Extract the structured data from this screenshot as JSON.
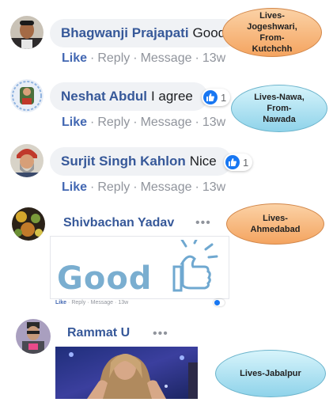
{
  "comments": [
    {
      "name": "Bhagwanji Prajapati",
      "text": "Good",
      "like": "Like",
      "reply": "Reply",
      "message": "Message",
      "time": "13w"
    },
    {
      "name": "Neshat Abdul",
      "text": "I agree",
      "reaction_count": "1",
      "like": "Like",
      "reply": "Reply",
      "message": "Message",
      "time": "13w"
    },
    {
      "name": "Surjit Singh Kahlon",
      "text": "Nice",
      "reaction_count": "1",
      "like": "Like",
      "reply": "Reply",
      "message": "Message",
      "time": "13w"
    },
    {
      "name": "Shivbachan Yadav",
      "more": "•••",
      "sticker_text": "Good",
      "like": "Like",
      "reply": "Reply",
      "message": "Message",
      "time": "13w"
    },
    {
      "name": "Rammat U",
      "more": "•••"
    }
  ],
  "dot": "·",
  "annotations": [
    {
      "text": "Lives-Jogeshwari, From-Kutchchh",
      "color": "orange"
    },
    {
      "text": "Lives-Nawa, From-Nawada",
      "color": "blue"
    },
    {
      "text": "Lives-Ahmedabad",
      "color": "orange"
    },
    {
      "text": "Lives-Jabalpur",
      "color": "blue"
    }
  ],
  "colors": {
    "name": "#365899",
    "like": "#4267b2",
    "meta": "#90949c",
    "bubble": "#f0f2f5",
    "reaction": "#1877f2"
  }
}
